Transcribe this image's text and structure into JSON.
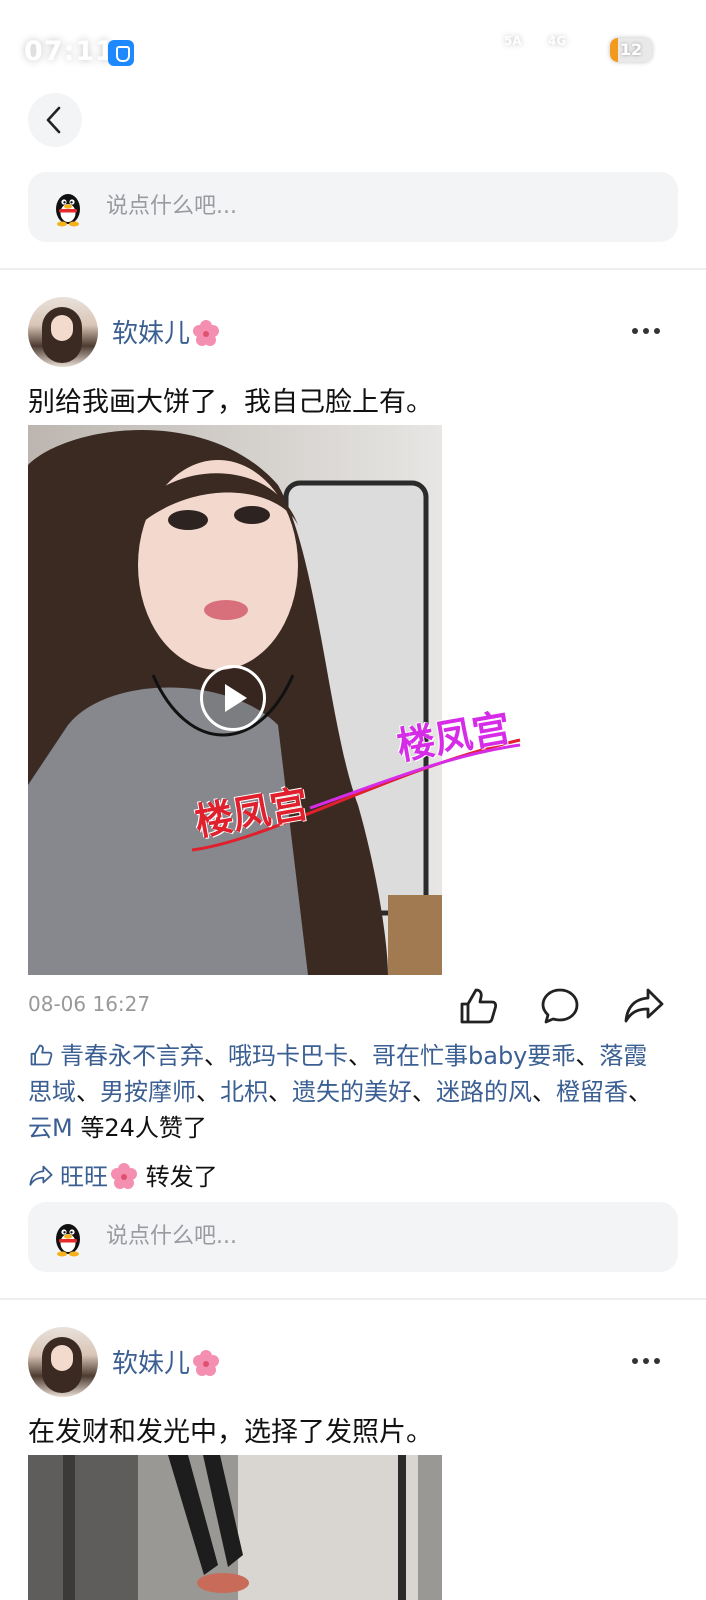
{
  "status_bar": {
    "time": "07:11",
    "network1": "5A",
    "network2": "4G",
    "battery": "12"
  },
  "top_comment": {
    "placeholder": "说点什么吧..."
  },
  "posts": [
    {
      "username": "软妹儿",
      "text": "别给我画大饼了，我自己脸上有。",
      "watermark1": "楼凤宫",
      "watermark2": "楼凤宫",
      "timestamp": "08-06 16:27",
      "like_names": [
        "青春永不言弃",
        "哦玛卡巴卡",
        "哥在忙事baby要乖",
        "落霞思域",
        "男按摩师",
        "北枳",
        "遗失的美好",
        "迷路的风",
        "橙留香",
        "云M"
      ],
      "like_suffix": "等24人赞了",
      "reposter": "旺旺",
      "repost_suffix": "转发了",
      "comment_placeholder": "说点什么吧..."
    },
    {
      "username": "软妹儿",
      "text": "在发财和发光中，选择了发照片。"
    }
  ],
  "colors": {
    "link": "#3b5f92",
    "muted": "#999999",
    "input_bg": "#f3f4f6",
    "watermark_red": "#e0202d",
    "watermark_magenta": "#d62ce8"
  }
}
